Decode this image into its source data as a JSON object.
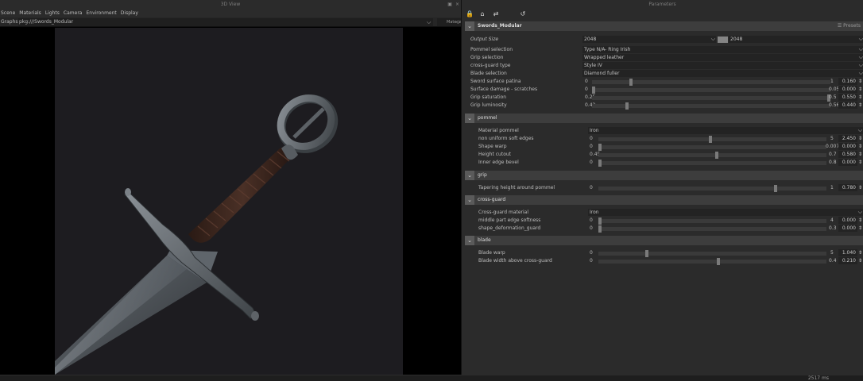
{
  "view3d": {
    "title": "3D View",
    "win_buttons": [
      "▣",
      "×"
    ],
    "menu": [
      "Scene",
      "Materials",
      "Lights",
      "Camera",
      "Environment",
      "Display"
    ],
    "graph_label": "Graphs :",
    "graph_path": "pkg:///Swords_Modular",
    "materials_select": "Materials"
  },
  "status": {
    "time": "2517 ms"
  },
  "params": {
    "title": "Parameters",
    "main_section": {
      "title": "Swords_Modular",
      "presets": "Presets"
    },
    "output_size": {
      "label": "Output Size",
      "value_a": "2048",
      "value_b": "2048"
    },
    "dropdowns": [
      {
        "label": "Pommel selection",
        "value": "Type N/A- Ring Irish"
      },
      {
        "label": "Grip selection",
        "value": "Wrapped leather"
      },
      {
        "label": "cross-guard type",
        "value": "Style IV"
      },
      {
        "label": "Blade selection",
        "value": "Diamond fuller"
      }
    ],
    "main_sliders": [
      {
        "label": "Sword surface patina",
        "min": "0",
        "max": "1",
        "value": "0.160",
        "fraction": 0.16
      },
      {
        "label": "Surface damage - scratches",
        "min": "0",
        "max": "0.05",
        "value": "0.000",
        "fraction": 0.0
      },
      {
        "label": "Grip saturation",
        "min": "0.25",
        "max": "0.5",
        "value": "0.550",
        "fraction": 1.0
      },
      {
        "label": "Grip luminosity",
        "min": "0.42",
        "max": "0.56",
        "value": "0.440",
        "fraction": 0.143
      }
    ],
    "pommel": {
      "title": "pommel",
      "material": {
        "label": "Material pommel",
        "value": "Iron"
      },
      "sliders": [
        {
          "label": "non uniform soft edges",
          "min": "0",
          "max": "5",
          "value": "2.450",
          "fraction": 0.49
        },
        {
          "label": "Shape warp",
          "min": "0",
          "max": "0.007",
          "value": "0.000",
          "fraction": 0.0
        },
        {
          "label": "Height cutout",
          "min": "0.45",
          "max": "0.7",
          "value": "0.580",
          "fraction": 0.52
        },
        {
          "label": "Inner edge bevel",
          "min": "0",
          "max": "0.8",
          "value": "0.000",
          "fraction": 0.0
        }
      ]
    },
    "grip": {
      "title": "grip",
      "sliders": [
        {
          "label": "Tapering height around pommel",
          "min": "0",
          "max": "1",
          "value": "0.780",
          "fraction": 0.78
        }
      ]
    },
    "crossguard": {
      "title": "cross-guard",
      "material": {
        "label": "Cross-guard material",
        "value": "Iron"
      },
      "sliders": [
        {
          "label": "middle part edge softness",
          "min": "0",
          "max": "4",
          "value": "0.000",
          "fraction": 0.0
        },
        {
          "label": "shape_deformation_guard",
          "min": "0",
          "max": "0.3",
          "value": "0.000",
          "fraction": 0.0
        }
      ]
    },
    "blade": {
      "title": "blade",
      "sliders": [
        {
          "label": "Blade warp",
          "min": "0",
          "max": "5",
          "value": "1.040",
          "fraction": 0.208
        },
        {
          "label": "Blade width above cross-guard",
          "min": "0",
          "max": "0.4",
          "value": "0.210",
          "fraction": 0.525
        }
      ]
    }
  }
}
